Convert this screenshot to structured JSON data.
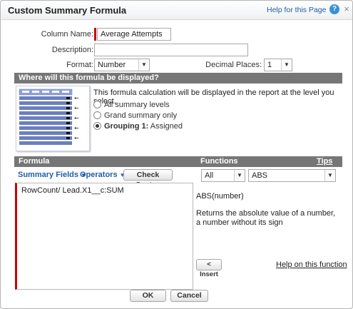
{
  "dialog": {
    "title": "Custom Summary Formula",
    "help_link": "Help for this Page",
    "help_icon": "?",
    "close_icon": "×"
  },
  "form": {
    "column_name_label": "Column Name:",
    "column_name_value": "Average Attempts",
    "description_label": "Description:",
    "description_value": "",
    "format_label": "Format:",
    "format_value": "Number",
    "decimal_places_label": "Decimal Places:",
    "decimal_places_value": "1"
  },
  "display_section": {
    "header": "Where will this formula be displayed?",
    "description": "This formula calculation will be displayed in the report at the level you select.",
    "options": [
      {
        "label": "All summary levels",
        "checked": false
      },
      {
        "label": "Grand summary only",
        "checked": false
      },
      {
        "label": "Grouping 1:",
        "suffix": " Assigned",
        "checked": true
      }
    ]
  },
  "formula_section": {
    "formula_header": "Formula",
    "functions_header": "Functions",
    "tips_link": "Tips",
    "summary_fields_label": "Summary Fields",
    "operators_label": "Operators",
    "dropdown_arrow": "▼",
    "check_syntax_label": "Check Syntax",
    "formula_text": "RowCount/ Lead.X1__c:SUM",
    "function_category": "All",
    "function_selected": "ABS",
    "function_signature": "ABS(number)",
    "function_description": "Returns the absolute value of a number, a number without its sign",
    "insert_label": "< Insert",
    "help_function_link": "Help on this function"
  },
  "footer": {
    "ok_label": "OK",
    "cancel_label": "Cancel"
  },
  "colors": {
    "accent_link": "#1f5fa8",
    "required_marker": "#cc0000",
    "section_bar": "#767676"
  }
}
